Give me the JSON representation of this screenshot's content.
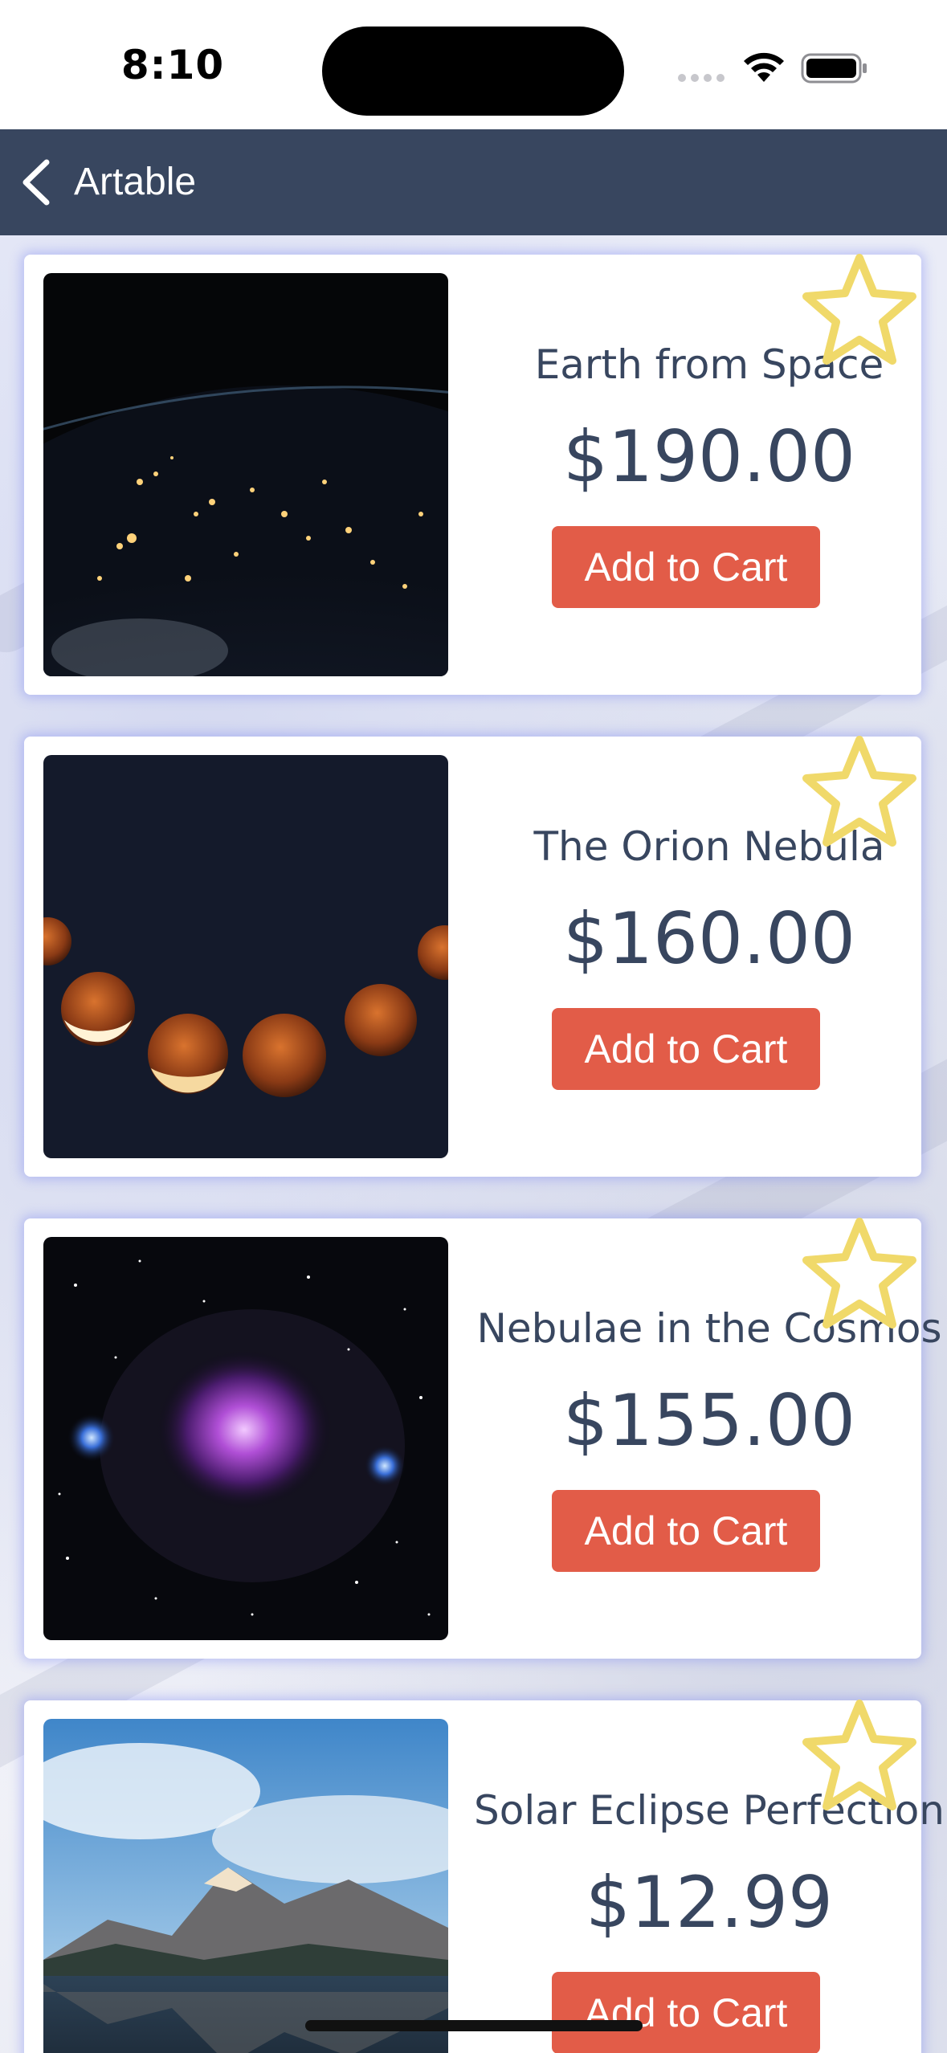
{
  "status_bar": {
    "time": "8:10"
  },
  "nav": {
    "title": "Artable"
  },
  "products": [
    {
      "title": "Earth from Space",
      "price": "$190.00",
      "button": "Add to Cart",
      "image": "earth-night-lights"
    },
    {
      "title": "The Orion Nebula",
      "price": "$160.00",
      "button": "Add to Cart",
      "image": "lunar-eclipse-phases"
    },
    {
      "title": "Nebulae in the Cosmos",
      "price": "$155.00",
      "button": "Add to Cart",
      "image": "orion-nebula"
    },
    {
      "title": "Solar Eclipse Perfection",
      "price": "$12.99",
      "button": "Add to Cart",
      "image": "mountain-lake"
    }
  ],
  "colors": {
    "nav_bar": "#38465f",
    "text": "#38465f",
    "button": "#e25c48",
    "star": "#f0d96a",
    "card_glow": "#6e78f0"
  },
  "icons": [
    "back-chevron-icon",
    "signal-icon",
    "wifi-icon",
    "battery-icon",
    "star-outline-icon"
  ]
}
